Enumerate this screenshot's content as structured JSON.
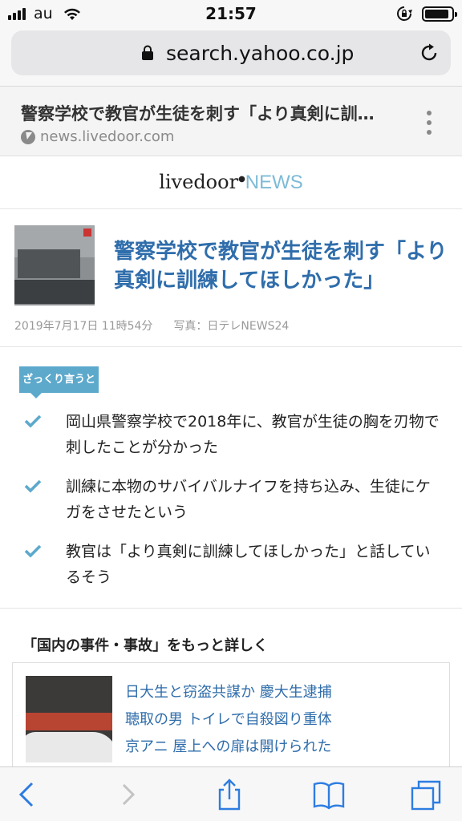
{
  "status_bar": {
    "carrier": "au",
    "time": "21:57",
    "battery_level": 0.92
  },
  "browser": {
    "url": "search.yahoo.co.jp"
  },
  "amp_header": {
    "title": "警察学校で教官が生徒を刺す「より真剣に訓…",
    "domain": "news.livedoor.com"
  },
  "logo": {
    "brand": "livedoor",
    "news": "NEWS",
    "accent_color": "#7dbbd6"
  },
  "article": {
    "headline": "警察学校で教官が生徒を刺す「より真剣に訓練してほしかった」",
    "date": "2019年7月17日 11時54分",
    "photo_credit": "写真：日テレNEWS24",
    "headline_color": "#2f6dab"
  },
  "summary": {
    "tag": "ざっくり言うと",
    "points": [
      "岡山県警察学校で2018年に、教官が生徒の胸を刃物で刺したことが分かった",
      "訓練に本物のサバイバルナイフを持ち込み、生徒にケガをさせたという",
      "教官は「より真剣に訓練してほしかった」と話しているそう"
    ]
  },
  "related": {
    "title": "「国内の事件・事故」をもっと詳しく",
    "links": [
      "日大生と窃盗共謀か 慶大生逮捕",
      "聴取の男 トイレで自殺図り重体",
      "京アニ 屋上への扉は開けられた"
    ]
  },
  "toolbar": {
    "icons": [
      "back-icon",
      "forward-icon",
      "share-icon",
      "bookmarks-icon",
      "tabs-icon"
    ]
  }
}
